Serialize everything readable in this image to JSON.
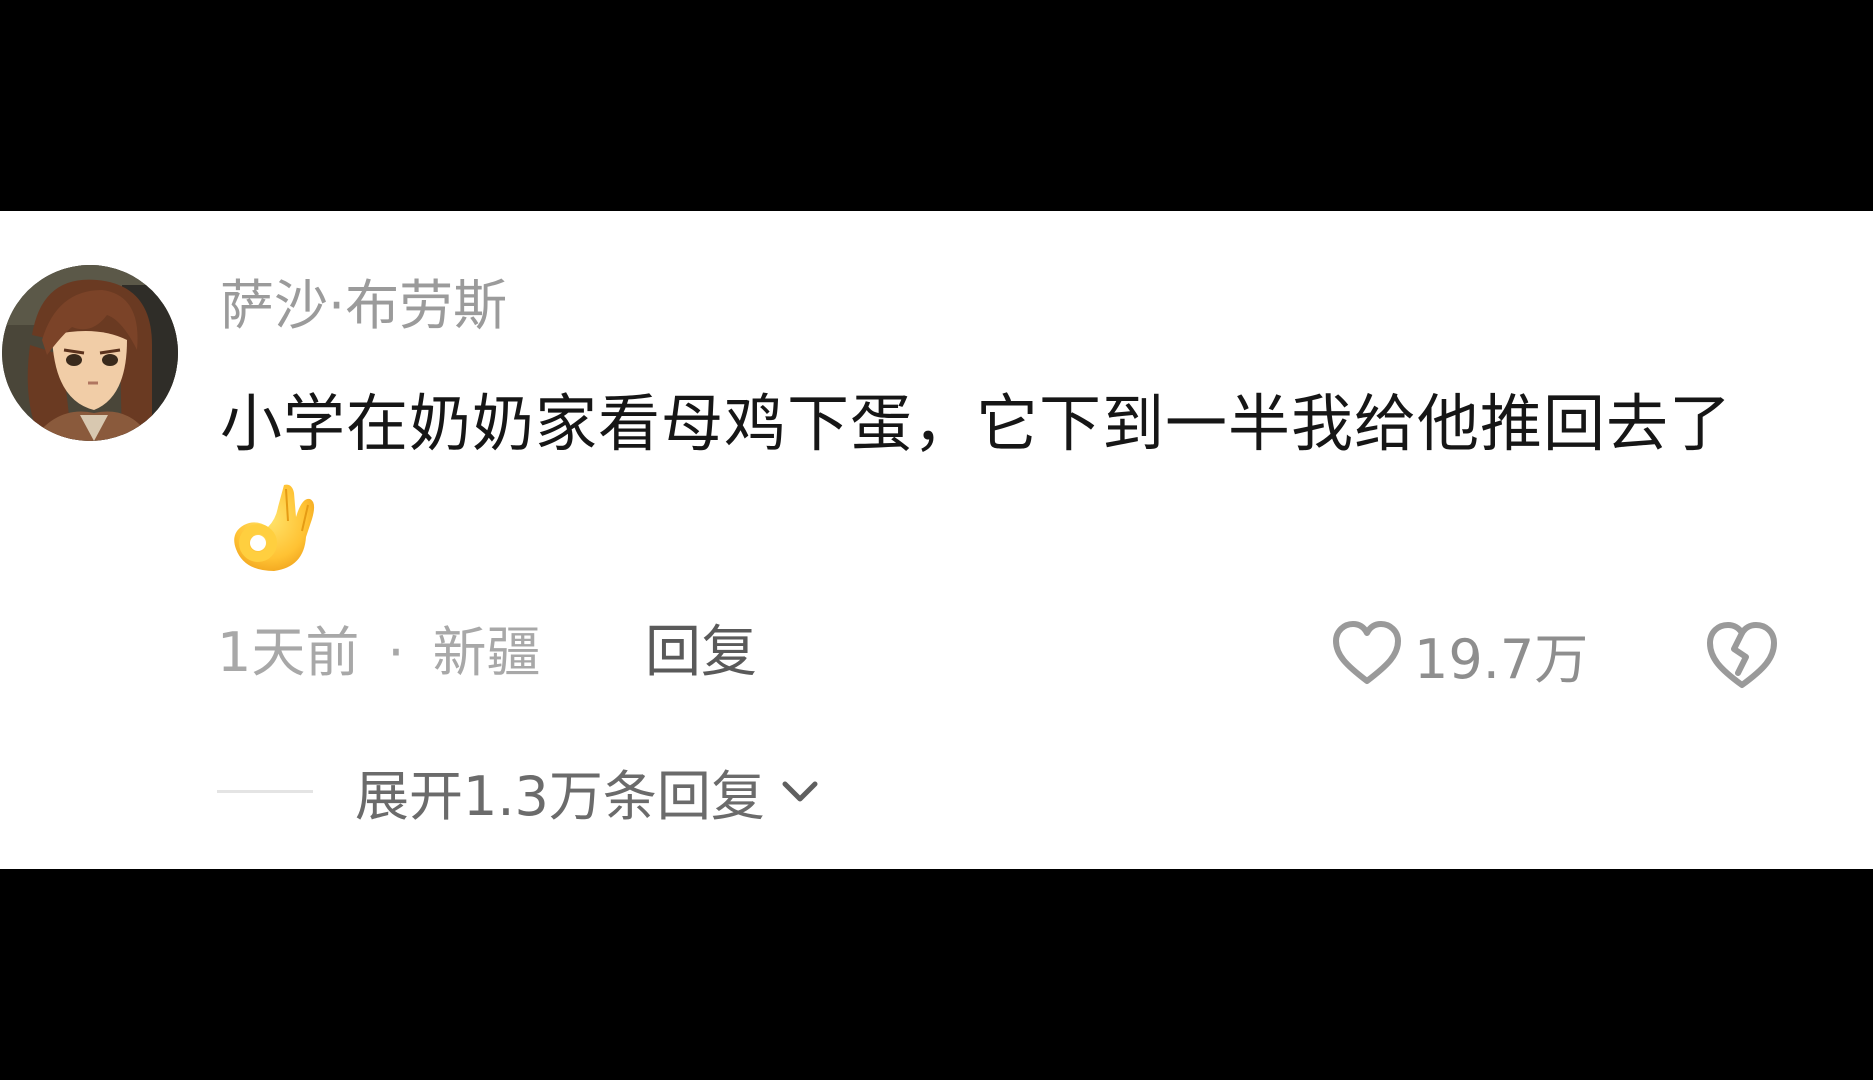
{
  "comment": {
    "username": "萨沙·布劳斯",
    "text": "小学在奶奶家看母鸡下蛋，它下到一半我给他推回去了",
    "time": "1天前",
    "separator": "·",
    "location": "新疆",
    "reply_label": "回复",
    "like_count": "19.7万",
    "expand_replies_label": "展开1.3万条回复",
    "emoji": "ok-hand",
    "icons": {
      "like": "heart-outline-icon",
      "dislike": "broken-heart-icon",
      "expand": "chevron-down-icon"
    }
  },
  "colors": {
    "background": "#000000",
    "card": "#ffffff",
    "username": "#9b9b9b",
    "text": "#161616",
    "meta": "#a8a8a8"
  }
}
